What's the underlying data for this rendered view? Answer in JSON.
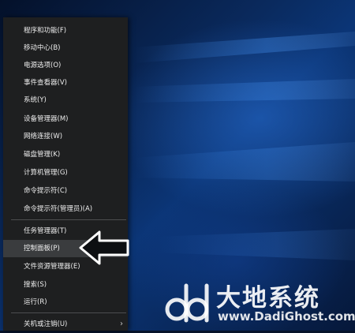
{
  "menu": {
    "items": [
      {
        "label": "程序和功能(F)"
      },
      {
        "label": "移动中心(B)"
      },
      {
        "label": "电源选项(O)"
      },
      {
        "label": "事件查看器(V)"
      },
      {
        "label": "系统(Y)"
      },
      {
        "label": "设备管理器(M)"
      },
      {
        "label": "网络连接(W)"
      },
      {
        "label": "磁盘管理(K)"
      },
      {
        "label": "计算机管理(G)"
      },
      {
        "label": "命令提示符(C)"
      },
      {
        "label": "命令提示符(管理员)(A)"
      },
      {
        "label": "任务管理器(T)"
      },
      {
        "label": "控制面板(P)"
      },
      {
        "label": "文件资源管理器(E)"
      },
      {
        "label": "搜索(S)"
      },
      {
        "label": "运行(R)"
      },
      {
        "label": "关机或注销(U)"
      }
    ],
    "highlighted_item": "控制面板(P)"
  },
  "watermark": {
    "title": "大地系统",
    "url": "www.DadiGhost.com"
  },
  "colors": {
    "menu_bg": "#1e1f20",
    "menu_text": "#eeeeee",
    "highlight_bg": "#3a3c3e",
    "desktop_blue": "#0b3576"
  },
  "icons": [
    "left-arrow-pointer-icon",
    "chevron-right-icon",
    "dd-logo-icon"
  ]
}
